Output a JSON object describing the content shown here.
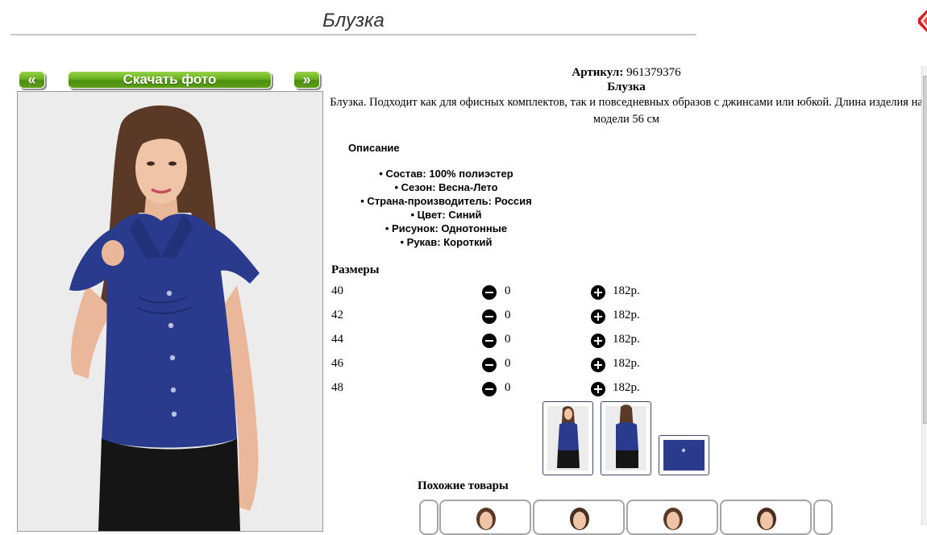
{
  "header": {
    "title": "Блузка"
  },
  "nav": {
    "prev_label": "«",
    "download_label": "Скачать фото",
    "next_label": "»"
  },
  "product": {
    "article_label": "Артикул:",
    "article_value": "961379376",
    "name": "Блузка",
    "description": "Блузка. Подходит как для офисных комплектов, так и повседневных образов с джинсами или юбкой. Длина изделия на модели 56 см"
  },
  "details": {
    "title": "Описание",
    "properties": [
      "• Состав: 100% полиэстер",
      "• Сезон: Весна-Лето",
      "• Страна-производитель: Россия",
      "• Цвет: Синий",
      "• Рисунок: Однотонные",
      "• Рукав: Короткий"
    ]
  },
  "sizes": {
    "title": "Размеры",
    "rows": [
      {
        "size": "40",
        "qty": "0",
        "price": "182р."
      },
      {
        "size": "42",
        "qty": "0",
        "price": "182р."
      },
      {
        "size": "44",
        "qty": "0",
        "price": "182р."
      },
      {
        "size": "46",
        "qty": "0",
        "price": "182р."
      },
      {
        "size": "48",
        "qty": "0",
        "price": "182р."
      }
    ]
  },
  "similar": {
    "title": "Похожие товары"
  },
  "colors": {
    "shirt": "#2a3a8c",
    "accent_green": "#6bb022",
    "thumb_border": "#3b4a6b"
  },
  "icons": {
    "minus": "minus-circle-icon",
    "plus": "plus-circle-icon",
    "close": "close-icon"
  }
}
